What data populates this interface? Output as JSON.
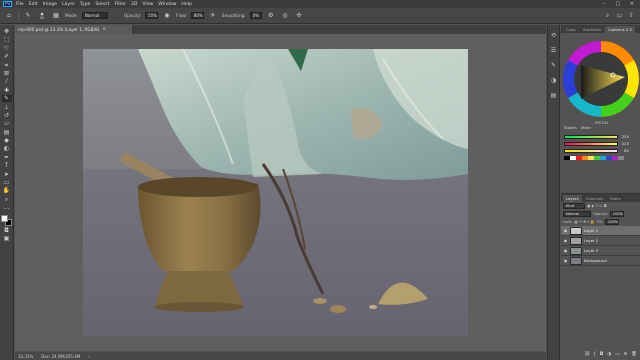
{
  "menubar": {
    "logo": "Ps",
    "items": [
      "File",
      "Edit",
      "Image",
      "Layer",
      "Type",
      "Select",
      "Filter",
      "3D",
      "View",
      "Window",
      "Help"
    ]
  },
  "options": {
    "brush_size": "29",
    "mode_label": "Mode:",
    "mode_value": "Normal",
    "opacity_label": "Opacity:",
    "opacity_value": "50%",
    "flow_label": "Flow:",
    "flow_value": "80%",
    "smoothing_label": "Smoothing:",
    "smoothing_value": "0%"
  },
  "document": {
    "tab_label": "mp-000.psd @ 33.3% (Layer 1, RGB/8)",
    "status_zoom": "33.33%",
    "status_doc": "Doc: 24.9M/205.4M"
  },
  "colors_panel": {
    "tabs": [
      "Color",
      "Swatches",
      "Coolorus 2.5"
    ],
    "active_tab": "Coolorus 2.5",
    "hex": "FFE152",
    "subtabs": [
      "Sliders",
      "Mixer"
    ],
    "slider_values": [
      "255",
      "225",
      "82"
    ]
  },
  "layers_panel": {
    "tabs": [
      "Layers",
      "Channels",
      "Paths"
    ],
    "filter_label": "Kind",
    "blend_mode": "Normal",
    "opacity_label": "Opacity:",
    "opacity_value": "100%",
    "lock_label": "Lock:",
    "fill_label": "Fill:",
    "fill_value": "100%",
    "layers": [
      {
        "name": "Layer 1",
        "selected": true
      },
      {
        "name": "Layer 2",
        "selected": false
      },
      {
        "name": "Layer 3",
        "selected": false
      },
      {
        "name": "Background",
        "selected": false
      }
    ]
  }
}
